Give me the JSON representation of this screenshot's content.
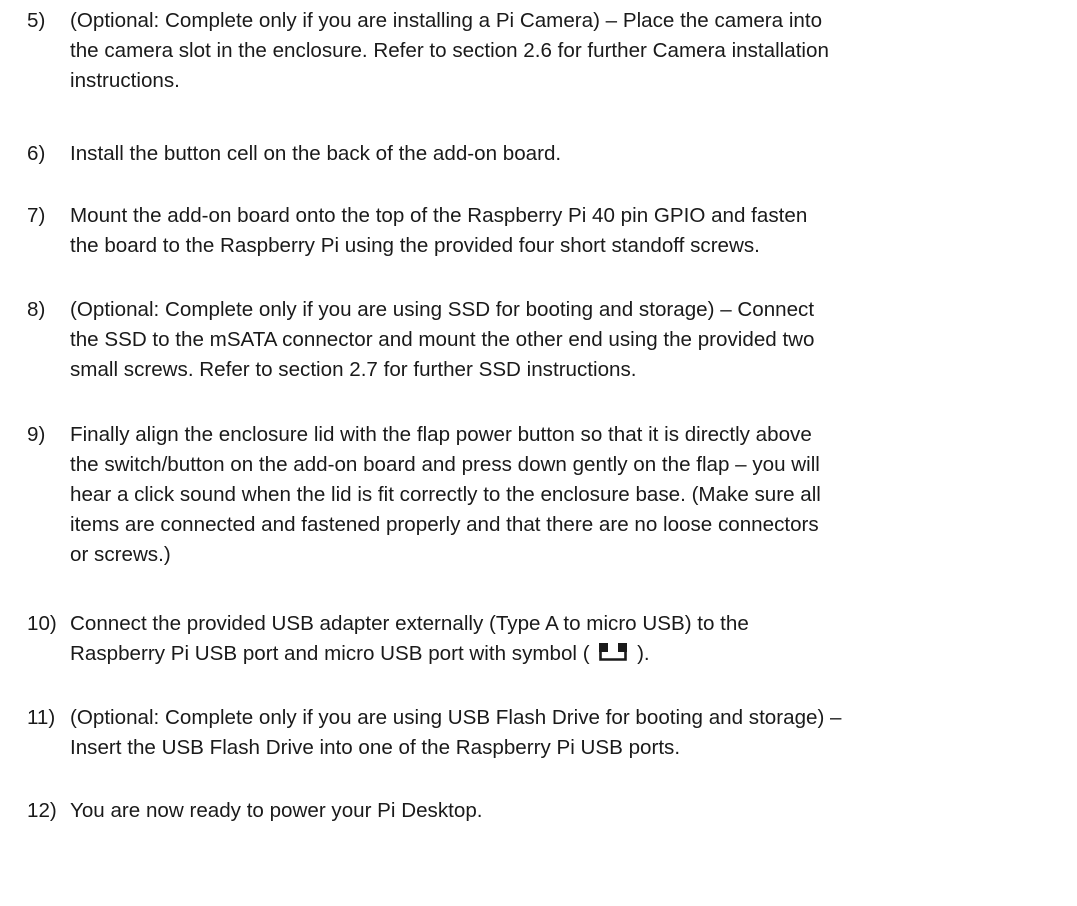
{
  "steps": [
    {
      "number": "5)",
      "lines": [
        "(Optional: Complete only if you are installing a Pi Camera) – Place the camera into",
        "the camera slot in the enclosure. Refer to section 2.6 for further Camera installation",
        "instructions."
      ]
    },
    {
      "number": "6)",
      "lines": [
        "Install the button cell on the back of the add-on board."
      ]
    },
    {
      "number": "7)",
      "lines": [
        "Mount the add-on board onto the top of the Raspberry Pi 40 pin GPIO and fasten",
        "the board to the Raspberry Pi using the provided four short standoff screws."
      ]
    },
    {
      "number": "8)",
      "lines": [
        "(Optional: Complete only if you are using SSD for booting and storage) – Connect",
        "the SSD to the mSATA connector and mount the other end using the provided two",
        "small screws. Refer to section 2.7 for further SSD instructions."
      ]
    },
    {
      "number": "9)",
      "lines": [
        "Finally align the enclosure lid with the flap power button so that it is directly above",
        "the switch/button on the add-on board and press down gently on the flap – you will",
        "hear a click sound when the lid is fit correctly to the enclosure base. (Make sure all",
        "items are connected and fastened properly and that there are no loose connectors",
        "or screws.)"
      ]
    },
    {
      "number": "10)",
      "lines": [
        "Connect the provided USB adapter externally (Type A to micro USB) to the"
      ],
      "line2_before_icon": "Raspberry Pi USB port and micro USB port with symbol (",
      "line2_after_icon": ").",
      "icon": "power-port-symbol-icon"
    },
    {
      "number": "11)",
      "lines": [
        "(Optional: Complete only if you are using USB Flash Drive for booting and storage) –",
        "Insert the USB Flash Drive into one of the Raspberry Pi USB ports."
      ]
    },
    {
      "number": "12)",
      "lines": [
        "You are now ready to power your Pi Desktop."
      ]
    }
  ]
}
